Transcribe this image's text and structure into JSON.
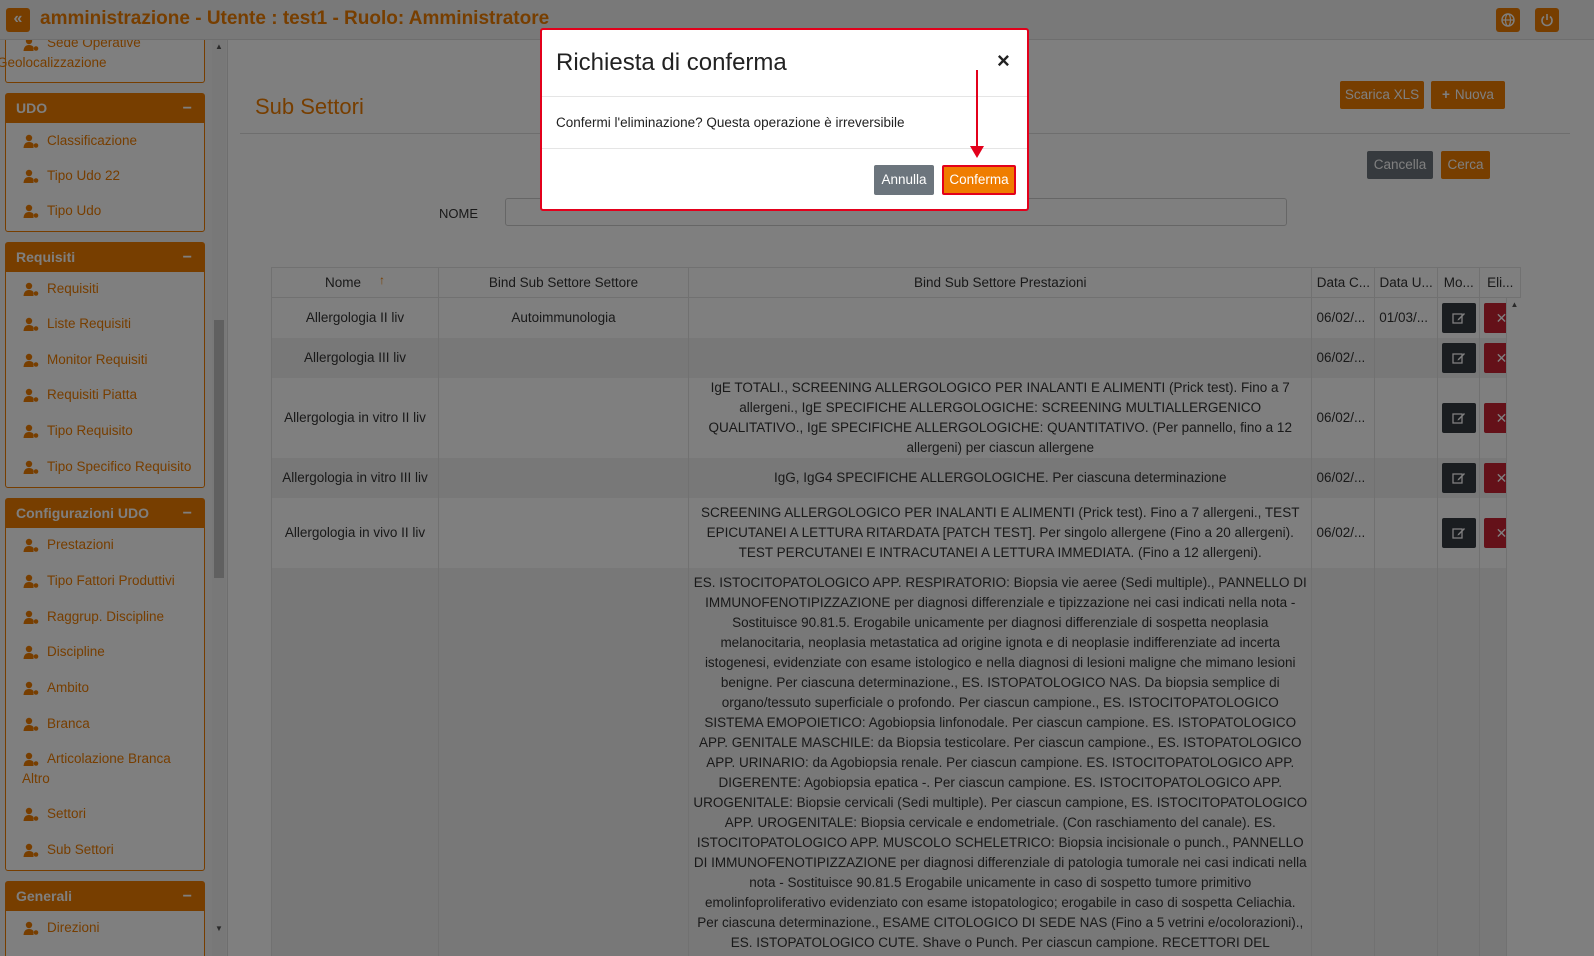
{
  "header": {
    "back_icon": "«",
    "title": "amministrazione - Utente : test1 - Ruolo: Amministratore"
  },
  "sidebar": {
    "top_items": [
      "Sede Operative",
      "Geolocalizzazione"
    ],
    "groups": [
      {
        "title": "UDO",
        "items": [
          "Classificazione",
          "Tipo Udo 22",
          "Tipo Udo"
        ]
      },
      {
        "title": "Requisiti",
        "items": [
          "Requisiti",
          "Liste Requisiti",
          "Monitor Requisiti",
          "Requisiti Piatta",
          "Tipo Requisito",
          "Tipo Specifico Requisito"
        ]
      },
      {
        "title": "Configurazioni UDO",
        "items": [
          "Prestazioni",
          "Tipo Fattori Produttivi",
          "Raggrup. Discipline",
          "Discipline",
          "Ambito",
          "Branca",
          "Articolazione Branca Altro",
          "Settori",
          "Sub Settori"
        ]
      },
      {
        "title": "Generali",
        "items": [
          "Direzioni"
        ]
      }
    ],
    "collapse_symbol": "−"
  },
  "main": {
    "page_title": "Sub Settori",
    "buttons": {
      "export": "Scarica XLS",
      "new": "Nuova",
      "new_icon": "+",
      "clear": "Cancella",
      "search": "Cerca"
    },
    "filter": {
      "label": "NOME",
      "value": ""
    },
    "table": {
      "columns": [
        "Nome",
        "Bind Sub Settore Settore",
        "Bind Sub Settore Prestazioni",
        "Data C...",
        "Data U...",
        "Mo...",
        "Eli..."
      ],
      "sort_icon": "↑",
      "rows": [
        {
          "nome": "Allergologia II liv",
          "settore": "Autoimmunologia",
          "prestazioni": "",
          "data_c": "06/02/...",
          "data_u": "01/03/..."
        },
        {
          "nome": "Allergologia III liv",
          "settore": "",
          "prestazioni": "",
          "data_c": "06/02/...",
          "data_u": ""
        },
        {
          "nome": "Allergologia in vitro II liv",
          "settore": "",
          "prestazioni": "IgE TOTALI., SCREENING ALLERGOLOGICO PER INALANTI E ALIMENTI (Prick test). Fino a 7 allergeni., IgE SPECIFICHE ALLERGOLOGICHE: SCREENING MULTIALLERGENICO QUALITATIVO., IgE SPECIFICHE ALLERGOLOGICHE: QUANTITATIVO. (Per pannello, fino a 12 allergeni) per ciascun allergene",
          "data_c": "06/02/...",
          "data_u": ""
        },
        {
          "nome": "Allergologia in vitro III liv",
          "settore": "",
          "prestazioni": "IgG, IgG4 SPECIFICHE ALLERGOLOGICHE. Per ciascuna determinazione",
          "data_c": "06/02/...",
          "data_u": ""
        },
        {
          "nome": "Allergologia in vivo II liv",
          "settore": "",
          "prestazioni": "SCREENING ALLERGOLOGICO PER INALANTI E ALIMENTI (Prick test). Fino a 7 allergeni., TEST EPICUTANEI A LETTURA RITARDATA [PATCH TEST]. Per singolo allergene (Fino a 20 allergeni). TEST PERCUTANEI E INTRACUTANEI A LETTURA IMMEDIATA. (Fino a 12 allergeni).",
          "data_c": "06/02/...",
          "data_u": ""
        },
        {
          "nome": "",
          "settore": "",
          "prestazioni": "ES. ISTOCITOPATOLOGICO APP. RESPIRATORIO: Biopsia vie aeree (Sedi multiple)., PANNELLO DI IMMUNOFENOTIPIZZAZIONE per diagnosi differenziale e tipizzazione nei casi indicati nella nota - Sostituisce 90.81.5. Erogabile unicamente per diagnosi differenziale di sospetta neoplasia melanocitaria, neoplasia metastatica ad origine ignota e di neoplasie indifferenziate ad incerta istogenesi, evidenziate con esame istologico e nella diagnosi di lesioni maligne che mimano lesioni benigne. Per ciascuna determinazione., ES. ISTOPATOLOGICO NAS. Da biopsia semplice di organo/tessuto superficiale o profondo. Per ciascun campione., ES. ISTOCITOPATOLOGICO SISTEMA EMOPOIETICO: Agobiopsia linfonodale. Per ciascun campione. ES. ISTOPATOLOGICO APP. GENITALE MASCHILE: da Biopsia testicolare. Per ciascun campione., ES. ISTOPATOLOGICO APP. URINARIO: da Agobiopsia renale. Per ciascun campione. ES. ISTOCITOPATOLOGICO APP. DIGERENTE: Agobiopsia epatica -. Per ciascun campione. ES. ISTOCITOPATOLOGICO APP. UROGENITALE: Biopsie cervicali (Sedi multiple). Per ciascun campione, ES. ISTOCITOPATOLOGICO APP. UROGENITALE: Biopsia cervicale e endometriale. (Con raschiamento del canale). ES. ISTOCITOPATOLOGICO APP. MUSCOLO SCHELETRICO: Biopsia incisionale o punch., PANNELLO DI IMMUNOFENOTIPIZZAZIONE per diagnosi differenziale di patologia tumorale nei casi indicati nella nota - Sostituisce 90.81.5 Erogabile unicamente in caso di sospetto tumore primitivo emolinfoproliferativo evidenziato con esame istopatologico; erogabile in caso di sospetta Celiachia. Per ciascuna determinazione., ESAME CITOLOGICO DI SEDE NAS (Fino a 5 vetrini e/ocolorazioni)., ES. ISTOPATOLOGICO CUTE. Shave o Punch. Per ciascun campione. RECETTORI DEL PROGESTERONE., ES. CITOLOGICO DI VERSAMENTO o",
          "data_c": "",
          "data_u": ""
        }
      ]
    }
  },
  "modal": {
    "title": "Richiesta di conferma",
    "close_symbol": "×",
    "message": "Confermi l'eliminazione? Questa operazione è irreversibile",
    "cancel_label": "Annulla",
    "confirm_label": "Conferma"
  },
  "colors": {
    "accent": "#ef7d00",
    "danger": "#c82333",
    "dark": "#343a40",
    "gray": "#6c757d",
    "annotation": "#e3001b"
  }
}
